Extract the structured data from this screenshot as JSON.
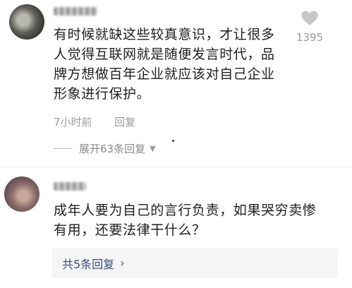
{
  "comments": [
    {
      "text_lines": [
        "有时候就缺这些较真意识，才让很多",
        "人觉得互联网就是随便发言时代，品",
        "牌方想做百年企业就应该对自己企业",
        "形象进行保护。"
      ],
      "time": "7小时前",
      "reply_label": "回复",
      "like_count": "1395",
      "expand_label": "展开63条回复"
    },
    {
      "text_lines": [
        "成年人要为自己的言行负责，如果哭穷卖惨",
        "有用，还要法律干什么？"
      ],
      "replies_label": "共5条回复",
      "replies_chevron": "›"
    }
  ]
}
